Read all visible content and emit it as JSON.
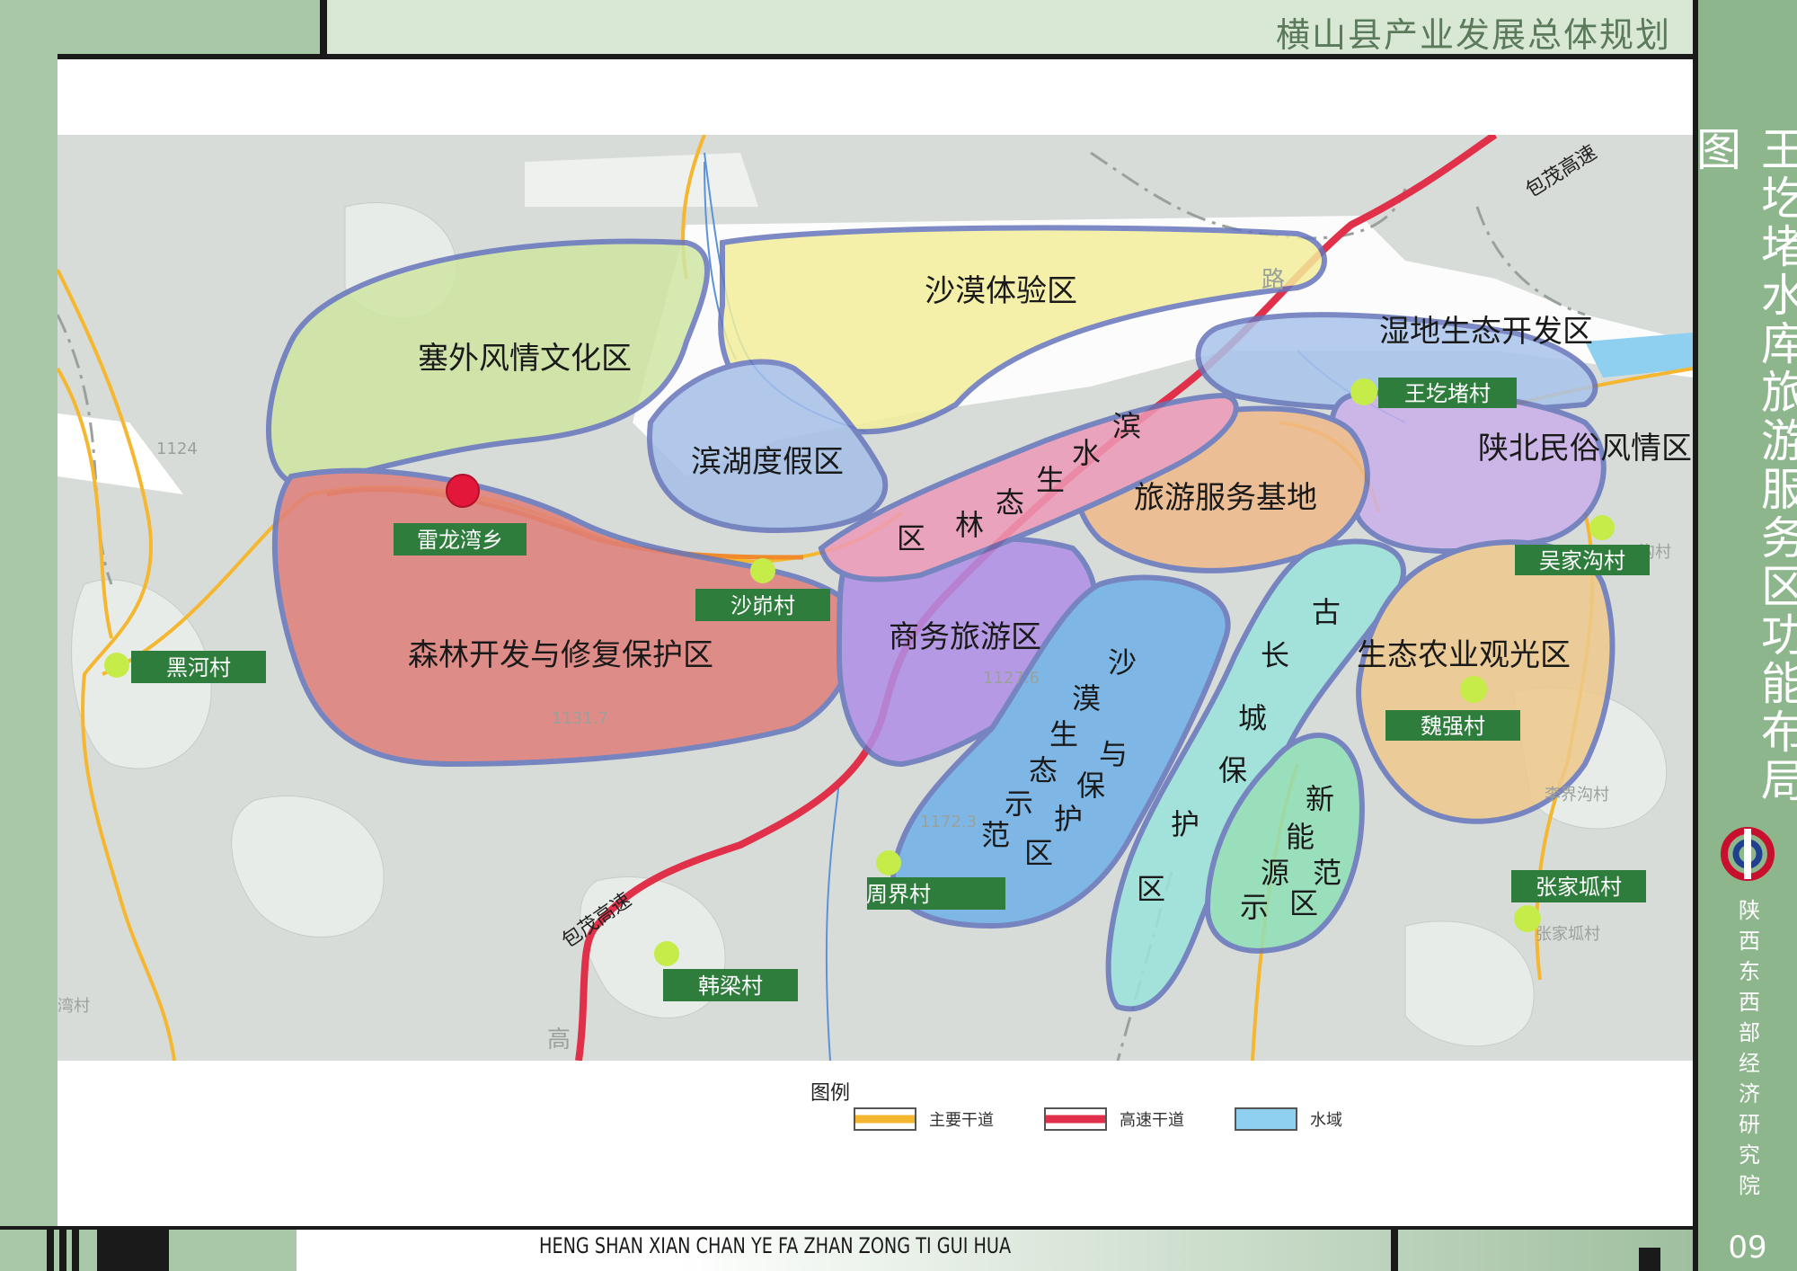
{
  "header": {
    "title": "横山县产业发展总体规划"
  },
  "sidebar": {
    "title": "王圪堵水库旅游服务区功能布局图",
    "organization": "陕西东西部经济研究院",
    "page_number": "09"
  },
  "footer": {
    "pinyin": "HENG SHAN XIAN CHAN YE FA ZHAN ZONG TI GUI HUA"
  },
  "map": {
    "zones": [
      {
        "label": "沙漠体验区",
        "color": "#f3ef9b"
      },
      {
        "label": "塞外风情文化区",
        "color": "#cfe6a3"
      },
      {
        "label": "湿地生态开发区",
        "color": "#a9c4ec"
      },
      {
        "label": "滨湖度假区",
        "color": "#a5bfe8"
      },
      {
        "label": "陕北民俗风情区",
        "color": "#cbb0ea"
      },
      {
        "label": "旅游服务基地",
        "color": "#f0b98a"
      },
      {
        "label": "森林开发与修复保护区",
        "color": "#e07f7a"
      },
      {
        "label": "商务旅游区",
        "color": "#b18ee8"
      },
      {
        "label": "生态农业观光区",
        "color": "#efc98c"
      }
    ],
    "vertical_zones": [
      {
        "label": "滨水生态林区",
        "chars": [
          "滨",
          "水",
          "生",
          "态",
          "林",
          "区"
        ],
        "color": "#ee9ab8"
      },
      {
        "label": "沙漠生态保护与示范区",
        "chars": [
          "沙",
          "漠",
          "生",
          "与",
          "态",
          "保",
          "示",
          "护",
          "范",
          "区"
        ],
        "color": "#6fb0e8"
      },
      {
        "label": "古长城保护区",
        "chars": [
          "古",
          "长",
          "城",
          "保",
          "护",
          "区"
        ],
        "color": "#99e4dc"
      },
      {
        "label": "新能源示范区",
        "chars": [
          "新",
          "能",
          "源",
          "范",
          "示",
          "区"
        ],
        "color": "#8fe0b8"
      }
    ],
    "villages": [
      {
        "label": "雷龙湾乡",
        "marker": "red"
      },
      {
        "label": "沙峁村"
      },
      {
        "label": "黑河村"
      },
      {
        "label": "王圪堵村"
      },
      {
        "label": "吴家沟村"
      },
      {
        "label": "魏强村"
      },
      {
        "label": "周界村"
      },
      {
        "label": "张家坬村"
      },
      {
        "label": "韩梁村"
      }
    ],
    "highway_labels": [
      "包茂高速",
      "包茂高速"
    ],
    "base_labels": [
      "1124",
      "1131.7",
      "1172.3",
      "1127.6",
      "李界沟村",
      "张家坬村",
      "湾村",
      "高",
      "路",
      "沟村"
    ]
  },
  "legend": {
    "title": "图例",
    "items": [
      {
        "label": "主要干道",
        "color": "#f5b730"
      },
      {
        "label": "高速干道",
        "color": "#e0304a"
      },
      {
        "label": "水域",
        "color": "#8fd0f0"
      }
    ]
  },
  "colors": {
    "frame": "#a8c8a8",
    "sidebar": "#8db68d",
    "village_label_bg": "#2e7d3c",
    "village_marker": "#c6ec4a"
  }
}
